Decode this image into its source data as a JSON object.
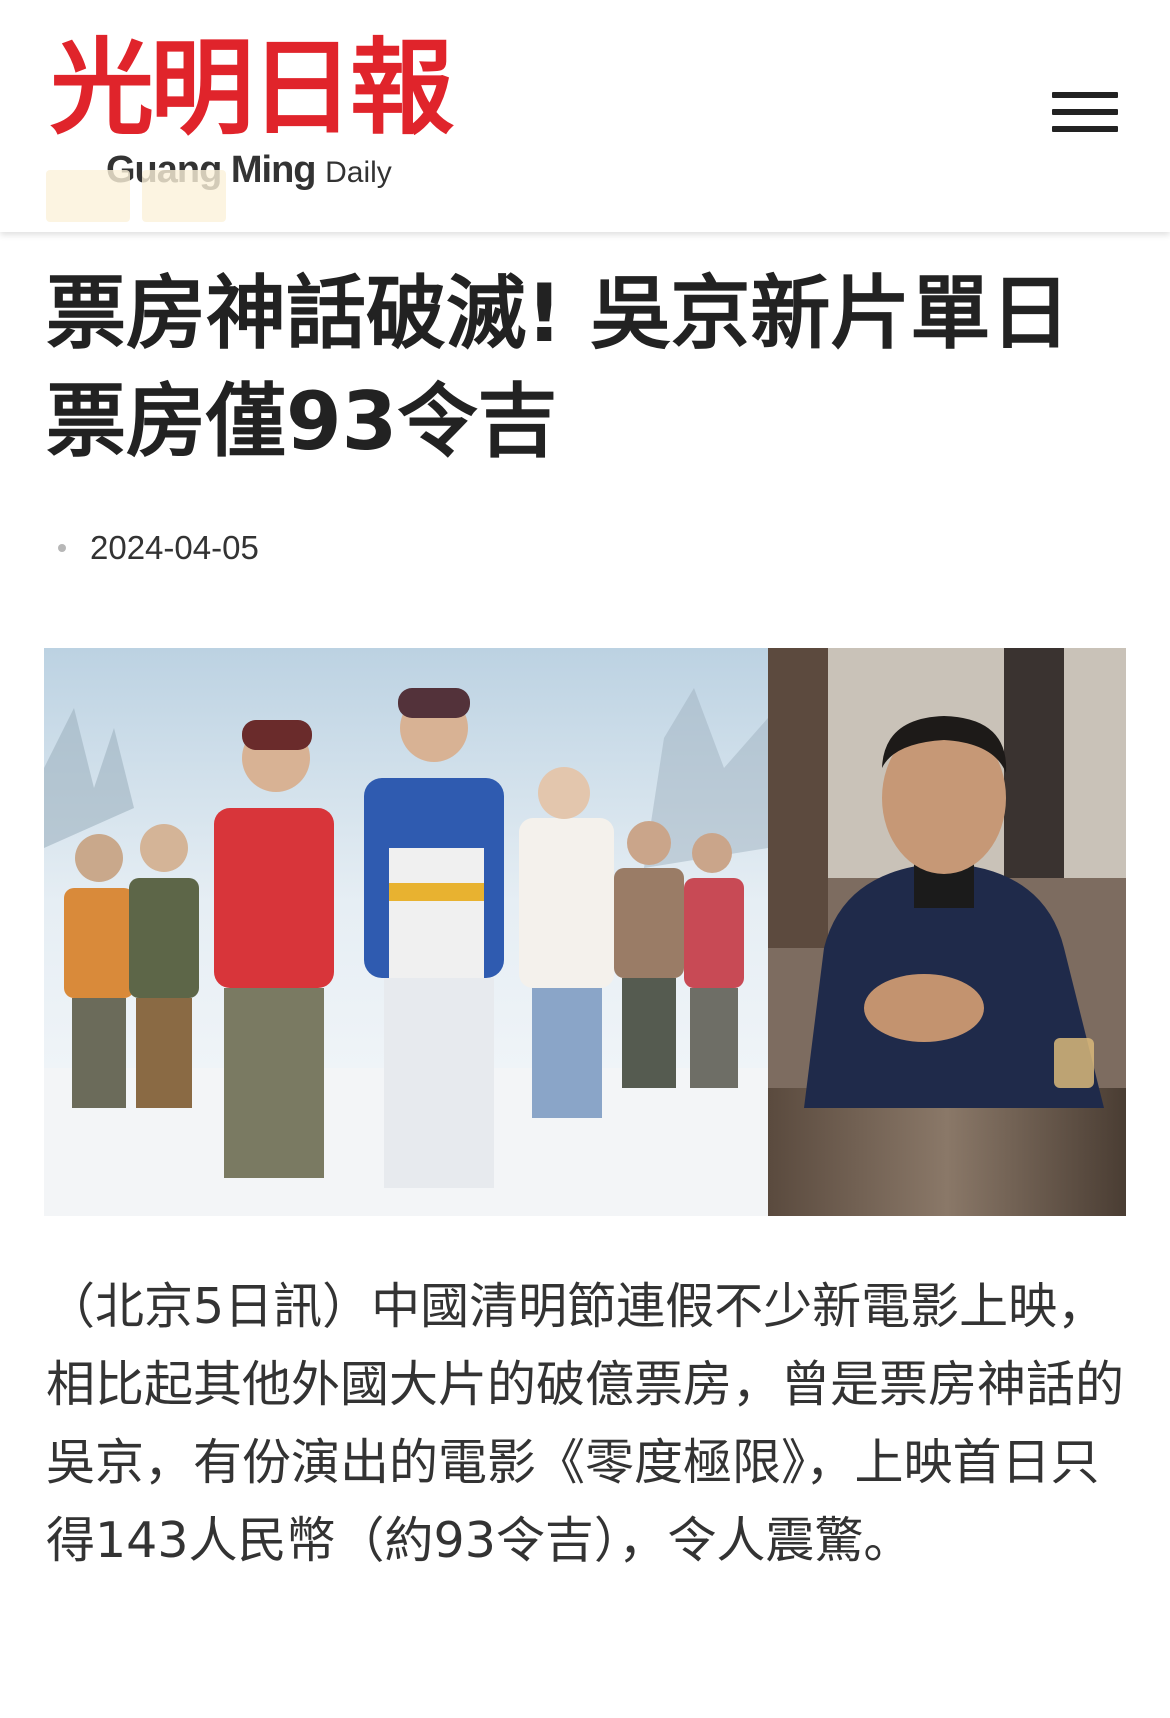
{
  "header": {
    "logo_cn": "光明日報",
    "logo_en": "Guang Ming",
    "logo_en_daily": "Daily",
    "menu_icon": "hamburger-menu-icon",
    "brand_color": "#e0242b"
  },
  "article": {
    "title": "票房神話破滅! 吳京新片單日票房僅93令吉",
    "date": "2024-04-05",
    "image_alt": "零度極限 movie poster and Wu Jing",
    "paragraph": "（北京5日訊）中國清明節連假不少新電影上映，相比起其他外國大片的破億票房，曾是票房神話的吳京，有份演出的電影《零度極限》，上映首日只得143人民幣（約93令吉），令人震驚。"
  }
}
